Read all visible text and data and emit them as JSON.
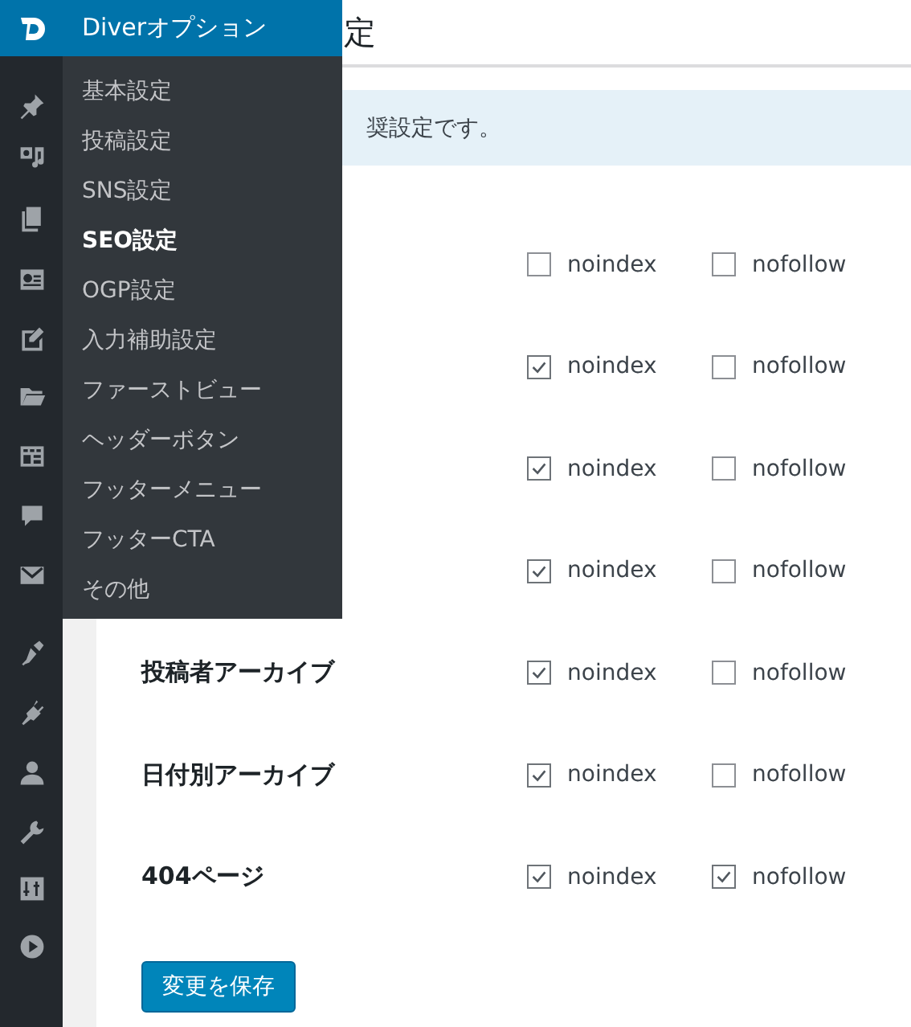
{
  "page": {
    "title": "定",
    "notice": "奨設定です。"
  },
  "flyout": {
    "title": "Diverオプション",
    "items": [
      {
        "label": "基本設定",
        "selected": false
      },
      {
        "label": "投稿設定",
        "selected": false
      },
      {
        "label": "SNS設定",
        "selected": false
      },
      {
        "label": "SEO設定",
        "selected": true
      },
      {
        "label": "OGP設定",
        "selected": false
      },
      {
        "label": "入力補助設定",
        "selected": false
      },
      {
        "label": "ファーストビュー",
        "selected": false
      },
      {
        "label": "ヘッダーボタン",
        "selected": false
      },
      {
        "label": "フッターメニュー",
        "selected": false
      },
      {
        "label": "フッターCTA",
        "selected": false
      },
      {
        "label": "その他",
        "selected": false
      }
    ]
  },
  "rows": [
    {
      "options": [
        {
          "label": "noindex",
          "checked": false
        },
        {
          "label": "nofollow",
          "checked": false
        }
      ]
    },
    {
      "options": [
        {
          "label": "noindex",
          "checked": true
        },
        {
          "label": "nofollow",
          "checked": false
        }
      ]
    },
    {
      "options": [
        {
          "label": "noindex",
          "checked": true
        },
        {
          "label": "nofollow",
          "checked": false
        }
      ]
    },
    {
      "options": [
        {
          "label": "noindex",
          "checked": true
        },
        {
          "label": "nofollow",
          "checked": false
        }
      ]
    },
    {
      "label": "投稿者アーカイブ",
      "options": [
        {
          "label": "noindex",
          "checked": true
        },
        {
          "label": "nofollow",
          "checked": false
        }
      ]
    },
    {
      "label": "日付別アーカイブ",
      "options": [
        {
          "label": "noindex",
          "checked": true
        },
        {
          "label": "nofollow",
          "checked": false
        }
      ]
    },
    {
      "label": "404ページ",
      "options": [
        {
          "label": "noindex",
          "checked": true
        },
        {
          "label": "nofollow",
          "checked": true
        }
      ]
    }
  ],
  "save_button": "変更を保存"
}
